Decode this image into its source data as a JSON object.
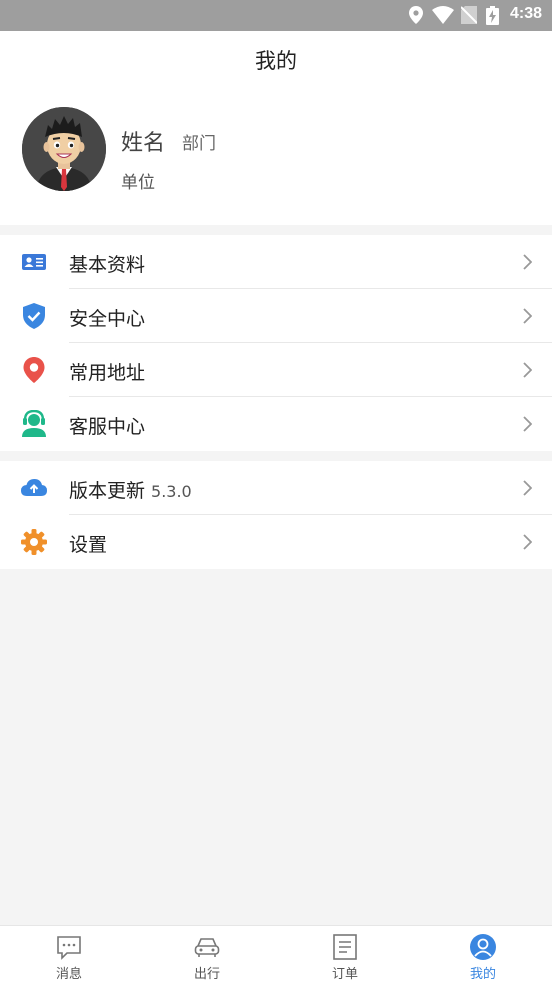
{
  "status_bar": {
    "time": "4:38"
  },
  "header": {
    "title": "我的"
  },
  "profile": {
    "name": "姓名",
    "department": "部门",
    "unit": "单位"
  },
  "menu_group_1": [
    {
      "label": "基本资料",
      "icon": "id-card-icon",
      "color": "#3a78d8"
    },
    {
      "label": "安全中心",
      "icon": "shield-check-icon",
      "color": "#3a86e0"
    },
    {
      "label": "常用地址",
      "icon": "location-pin-icon",
      "color": "#e9524a"
    },
    {
      "label": "客服中心",
      "icon": "headset-agent-icon",
      "color": "#1fb88a"
    }
  ],
  "menu_group_2": [
    {
      "label": "版本更新",
      "version": "5.3.0",
      "icon": "cloud-upload-icon",
      "color": "#3a86e0"
    },
    {
      "label": "设置",
      "icon": "gear-icon",
      "color": "#f0902a"
    }
  ],
  "tabbar": [
    {
      "label": "消息",
      "icon": "message-icon",
      "active": false
    },
    {
      "label": "出行",
      "icon": "car-icon",
      "active": false
    },
    {
      "label": "订单",
      "icon": "order-list-icon",
      "active": false
    },
    {
      "label": "我的",
      "icon": "user-icon",
      "active": true
    }
  ],
  "colors": {
    "accent": "#3a86e0",
    "background": "#f4f4f4"
  }
}
